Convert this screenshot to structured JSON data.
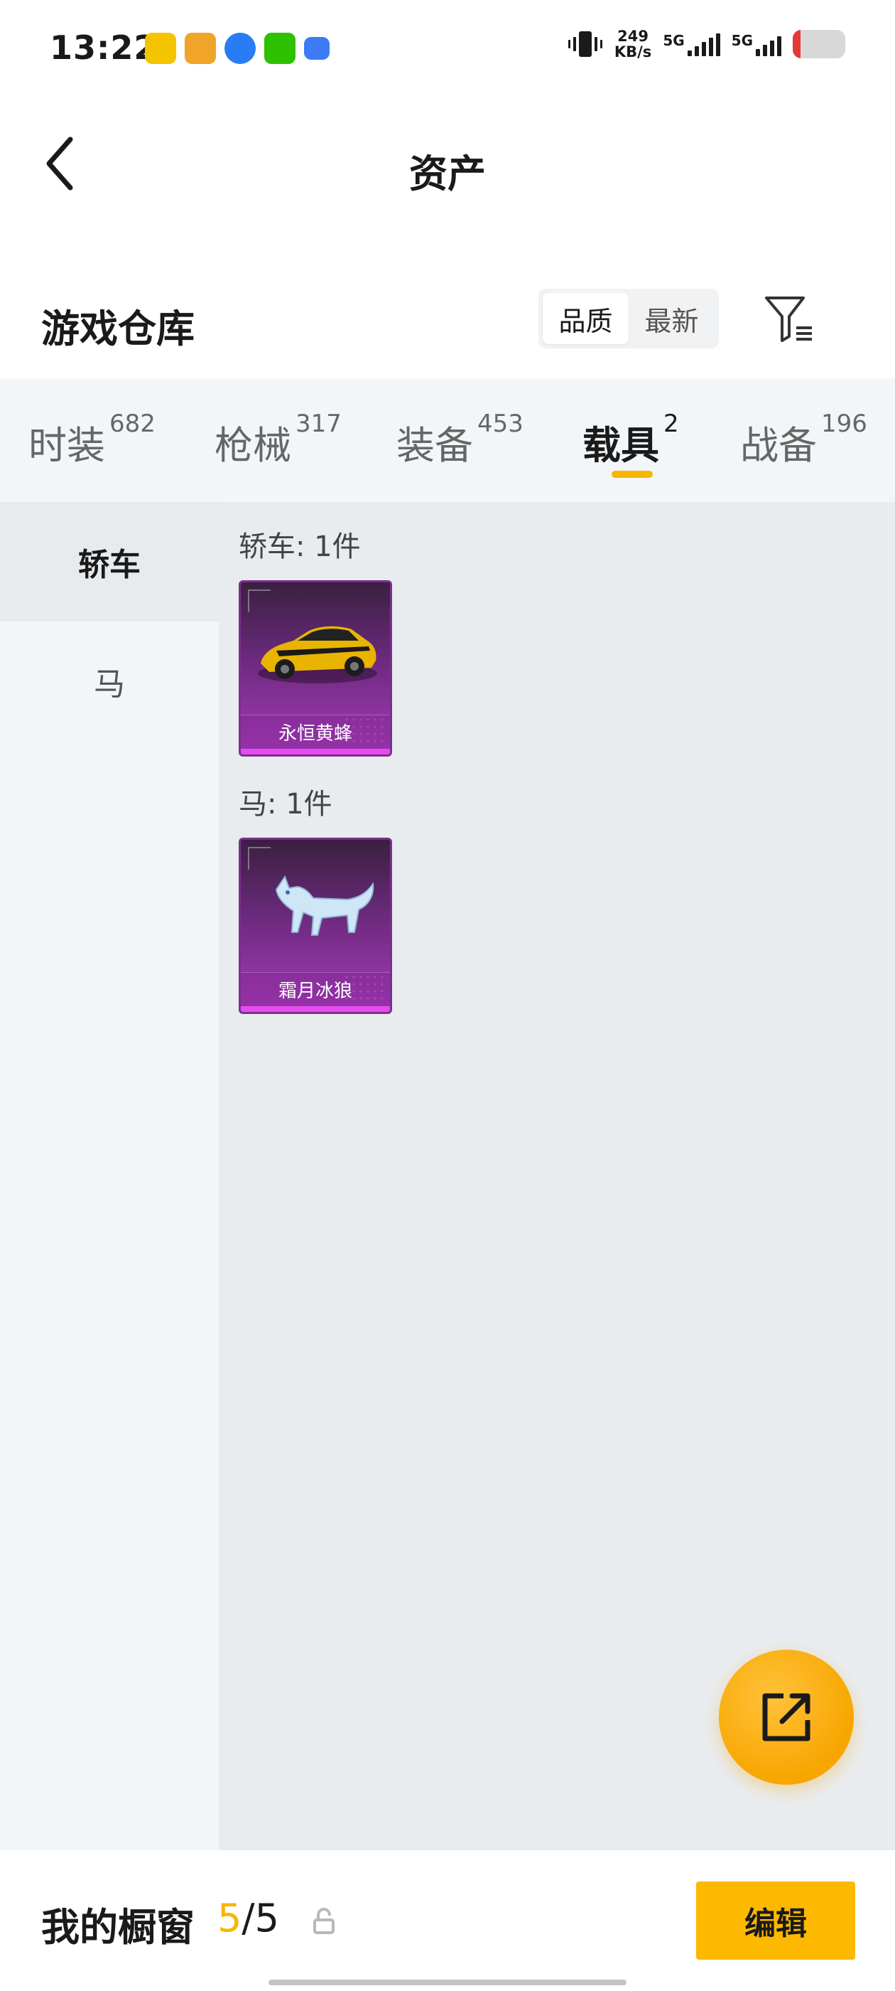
{
  "status_bar": {
    "time": "13:22",
    "net_speed_value": "249",
    "net_speed_unit": "KB/s",
    "sim1_label": "5G",
    "sim2_label": "5G",
    "battery_level": 0.15,
    "app_icons": [
      "game-app-icon",
      "game-app-icon-2",
      "browser-icon",
      "wechat-icon",
      "chat-app-icon"
    ],
    "colors": {
      "battery_low": "#e53935"
    }
  },
  "header": {
    "back_icon": "chevron-left-icon",
    "title": "资产"
  },
  "section": {
    "title": "游戏仓库",
    "sort_options": [
      "品质",
      "最新"
    ],
    "sort_selected": "品质",
    "filter_icon": "filter-icon"
  },
  "tabs": [
    {
      "label": "时装",
      "count": "682"
    },
    {
      "label": "枪械",
      "count": "317"
    },
    {
      "label": "装备",
      "count": "453"
    },
    {
      "label": "载具",
      "count": "2"
    },
    {
      "label": "战备",
      "count": "196"
    }
  ],
  "active_tab": "载具",
  "sidebar": {
    "items": [
      {
        "label": "轿车"
      },
      {
        "label": "马"
      }
    ],
    "active": "轿车"
  },
  "groups": [
    {
      "label": "轿车: 1件",
      "items": [
        {
          "name": "永恒黄蜂",
          "icon": "sports-car-icon"
        }
      ]
    },
    {
      "label": "马: 1件",
      "items": [
        {
          "name": "霜月冰狼",
          "icon": "ice-wolf-icon"
        }
      ]
    }
  ],
  "fab": {
    "icon": "share-export-icon"
  },
  "bottom_bar": {
    "label": "我的橱窗",
    "current": "5",
    "separator": "/",
    "total": "5",
    "lock_icon": "lock-icon",
    "edit_label": "编辑"
  },
  "theme": {
    "accent": "#f7b500",
    "card_purple": "#a63bb8"
  }
}
